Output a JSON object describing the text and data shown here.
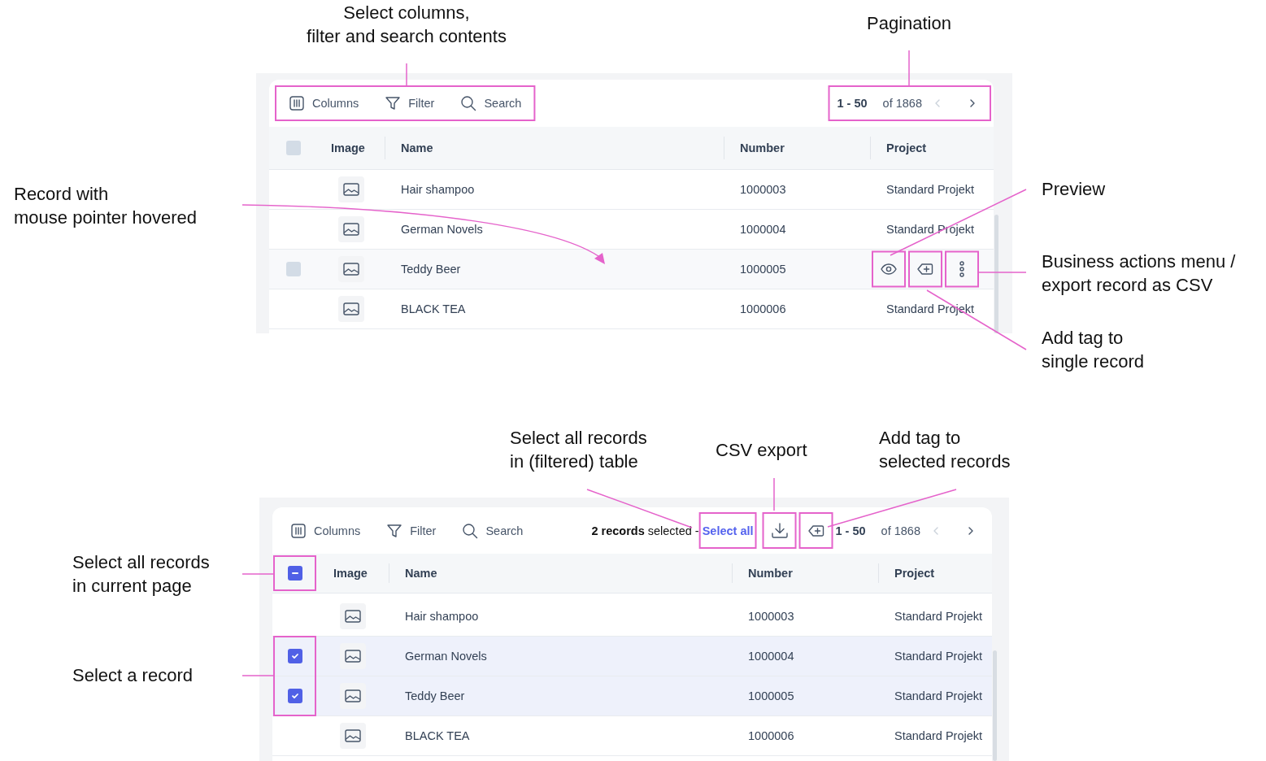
{
  "annotations": [
    {
      "text": "Select columns,\nfilter and search contents"
    },
    {
      "text": "Pagination"
    },
    {
      "text": "Record with\nmouse pointer hovered"
    },
    {
      "text": "Preview"
    },
    {
      "text": "Business actions menu /\nexport record as CSV"
    },
    {
      "text": "Add tag to\nsingle record"
    },
    {
      "text": "Select all records\nin (filtered) table"
    },
    {
      "text": "CSV export"
    },
    {
      "text": "Add tag to\nselected records"
    },
    {
      "text": "Select all records\nin current page"
    },
    {
      "text": "Select a record"
    }
  ],
  "panels": [
    {
      "toolbar": {
        "tools": [
          {
            "kind": "columns",
            "label": "Columns"
          },
          {
            "kind": "filter",
            "label": "Filter"
          },
          {
            "kind": "search",
            "label": "Search"
          }
        ]
      },
      "pagination": {
        "range": "1 - 50",
        "total": "of 1868",
        "prev": {
          "disabled": true
        },
        "next": {
          "disabled": false
        }
      },
      "header_checkbox": {
        "partial": false
      },
      "columns": [
        {
          "label": "Image"
        },
        {
          "label": "Name"
        },
        {
          "label": "Number"
        },
        {
          "label": "Project"
        }
      ],
      "rows": [
        {
          "name": "Hair shampoo",
          "number": "1000003",
          "project": "Standard Projekt",
          "hovered": false,
          "selected": false
        },
        {
          "name": "German Novels",
          "number": "1000004",
          "project": "Standard Projekt",
          "hovered": false,
          "selected": false
        },
        {
          "name": "Teddy Beer",
          "number": "1000005",
          "hovered": true,
          "selected": false
        },
        {
          "name": "BLACK TEA",
          "number": "1000006",
          "project": "Standard Projekt",
          "hovered": false,
          "selected": false
        }
      ]
    },
    {
      "toolbar": {
        "tools": [
          {
            "kind": "columns",
            "label": "Columns"
          },
          {
            "kind": "filter",
            "label": "Filter"
          },
          {
            "kind": "search",
            "label": "Search"
          }
        ]
      },
      "selection": {
        "count": "**2 records** selected -",
        "link": "Select all"
      },
      "pagination": {
        "range": "1 - 50",
        "total": "of 1868",
        "prev": {
          "disabled": true
        },
        "next": {
          "disabled": false
        }
      },
      "header_checkbox": {
        "partial": true
      },
      "columns": [
        {
          "label": "Image"
        },
        {
          "label": "Name"
        },
        {
          "label": "Number"
        },
        {
          "label": "Project"
        }
      ],
      "rows": [
        {
          "name": "Hair shampoo",
          "number": "1000003",
          "project": "Standard Projekt",
          "hovered": false,
          "selected": false
        },
        {
          "name": "German Novels",
          "number": "1000004",
          "project": "Standard Projekt",
          "hovered": false,
          "selected": true
        },
        {
          "name": "Teddy Beer",
          "number": "1000005",
          "project": "Standard Projekt",
          "hovered": false,
          "selected": true
        },
        {
          "name": "BLACK TEA",
          "number": "1000006",
          "project": "Standard Projekt",
          "hovered": false,
          "selected": false
        }
      ]
    }
  ]
}
